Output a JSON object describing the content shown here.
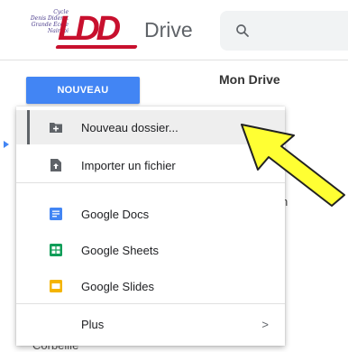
{
  "logo": {
    "script_lines": [
      "Cycle",
      "Denis Diderot",
      "Grande École",
      "Nairobi"
    ],
    "mark": "LDD"
  },
  "header": {
    "app_name": "Drive",
    "search_icon": "search-icon"
  },
  "sidebar": {
    "new_button": "NOUVEAU",
    "trash_label": "Corbeille"
  },
  "main": {
    "title": "Mon Drive",
    "peek_text": "h"
  },
  "menu": {
    "items": [
      {
        "label": "Nouveau dossier...",
        "icon": "folder-plus-icon"
      },
      {
        "label": "Importer un fichier",
        "icon": "file-upload-icon"
      },
      {
        "label": "Google Docs",
        "icon": "google-docs-icon",
        "color": "#4285f4"
      },
      {
        "label": "Google Sheets",
        "icon": "google-sheets-icon",
        "color": "#0f9d58"
      },
      {
        "label": "Google Slides",
        "icon": "google-slides-icon",
        "color": "#f4b400"
      },
      {
        "label": "Plus",
        "icon": "chevron-right-icon"
      }
    ],
    "more_chevron": ">"
  },
  "annotation": {
    "pointer": "yellow-arrow-icon",
    "pointer_color": "#ffff33"
  }
}
